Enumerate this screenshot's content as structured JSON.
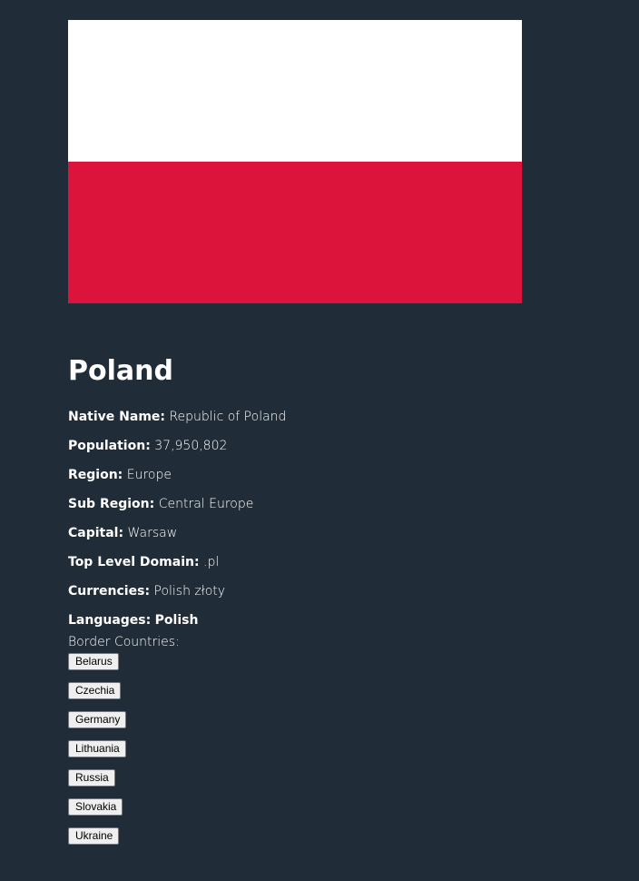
{
  "flag": {
    "top_color": "#ffffff",
    "bottom_color": "#dc143c"
  },
  "country": {
    "name": "Poland",
    "native_name_label": "Native Name:",
    "native_name": "Republic of Poland",
    "population_label": "Population:",
    "population": "37,950,802",
    "region_label": "Region:",
    "region": "Europe",
    "sub_region_label": "Sub Region:",
    "sub_region": "Central Europe",
    "capital_label": "Capital:",
    "capital": "Warsaw",
    "tld_label": "Top Level Domain:",
    "tld": ".pl",
    "currencies_label": "Currencies:",
    "currencies": "Polish złoty",
    "languages_label": "Languages:",
    "languages": "Polish"
  },
  "borders": {
    "title": "Border Countries:",
    "countries": [
      "Belarus",
      "Czechia",
      "Germany",
      "Lithuania",
      "Russia",
      "Slovakia",
      "Ukraine"
    ]
  },
  "colors": {
    "background": "#202c37",
    "text": "#ffffff",
    "button_bg": "#efefef"
  }
}
